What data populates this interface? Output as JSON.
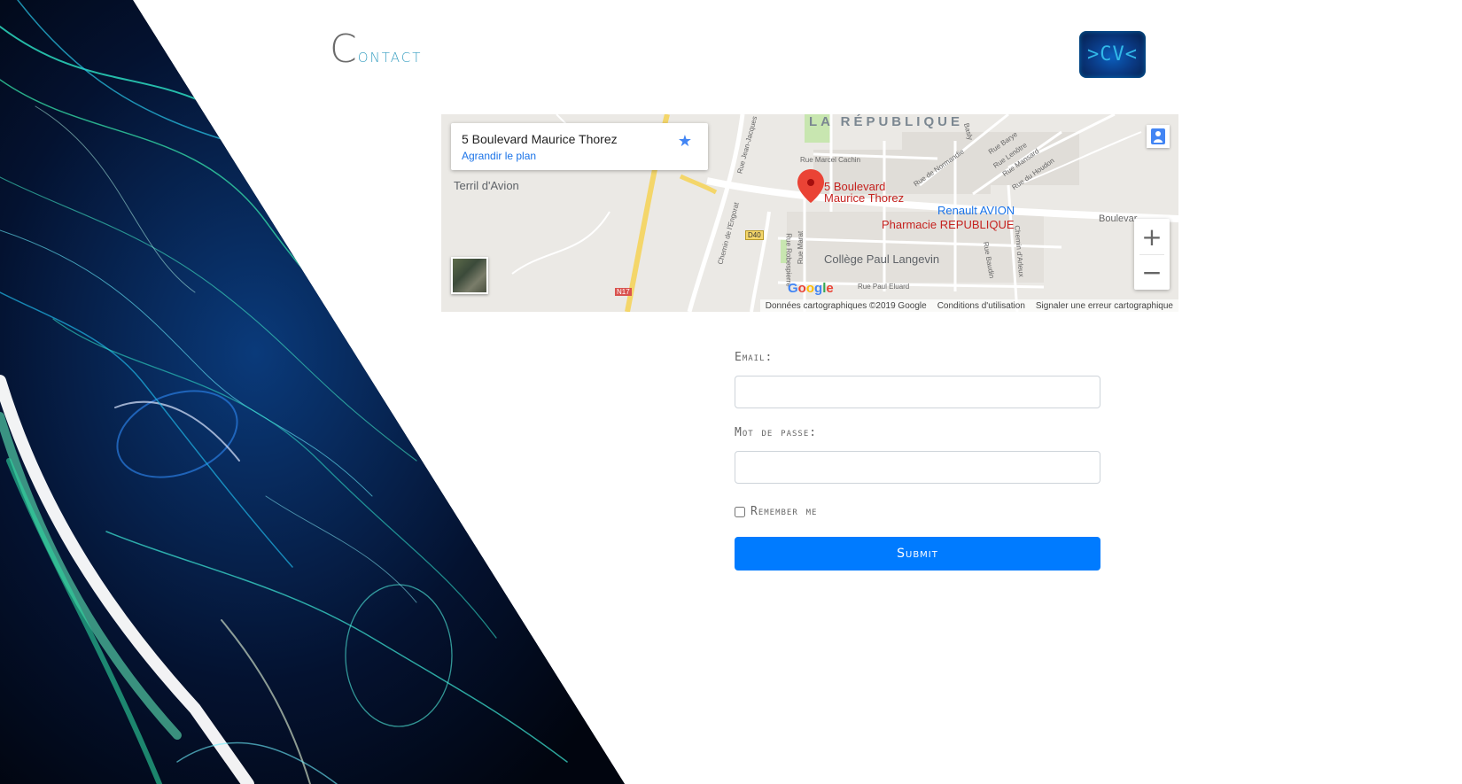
{
  "header": {
    "title_initial": "C",
    "title_rest": "ontact",
    "logo_text": ">CV<"
  },
  "map": {
    "place_name": "5 Boulevard Maurice Thorez",
    "enlarge_link": "Agrandir le plan",
    "district": "LA RÉPUBLIQUE",
    "marker_label_line1": "5 Boulevard",
    "marker_label_line2": "Maurice Thorez",
    "pois": {
      "terril": "Terril d'Avion",
      "renault": "Renault AVION",
      "pharmacie": "Pharmacie REPUBLIQUE",
      "college": "Collège Paul Langevin"
    },
    "streets": {
      "rue_marcel_cachin": "Rue Marcel Cachin",
      "rue_paul_eluard": "Rue Paul Eluard",
      "boulevard": "Boulevar",
      "rue_de_normandie": "Rue de Normandie",
      "rue_barye": "Rue Barye",
      "rue_lenotre": "Rue Lenôtre",
      "rue_mansard": "Rue Mansard",
      "rue_du_houdon": "Rue du Houdon",
      "rue_basly": "Basly",
      "rue_jean_jacques": "Rue Jean-Jacques",
      "chemin_engorat": "Chemin de l'Engorat",
      "rue_robespierre": "Rue Robespierre",
      "rue_marat": "Rue Marat",
      "rue_baudin": "Rue Baudin",
      "chemin_arleux": "Chemin d'Arleux",
      "route_d40": "D40",
      "route_n17": "N17"
    },
    "zoom_in": "+",
    "zoom_out": "−",
    "google_logo": "Google",
    "attribution": {
      "data": "Données cartographiques ©2019 Google",
      "terms": "Conditions d'utilisation",
      "report": "Signaler une erreur cartographique"
    }
  },
  "form": {
    "email_label": "Email:",
    "email_value": "",
    "password_label": "Mot de passe:",
    "password_value": "",
    "remember_label": "Remember me",
    "remember_checked": false,
    "submit_label": "Submit"
  },
  "colors": {
    "accent": "#007bff",
    "title_accent": "#3aa0c2",
    "link": "#1a73e8",
    "marker": "#ea4335"
  }
}
